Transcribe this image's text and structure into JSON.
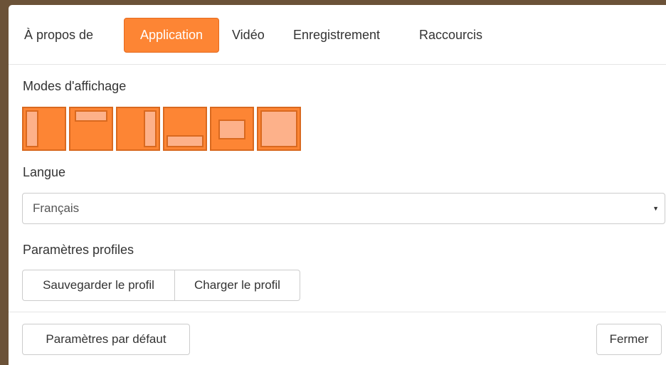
{
  "tabs": [
    {
      "label": "À propos de",
      "active": false
    },
    {
      "label": "Application",
      "active": true
    },
    {
      "label": "Vidéo",
      "active": false
    },
    {
      "label": "Enregistrement",
      "active": false
    },
    {
      "label": "Raccourcis",
      "active": false
    }
  ],
  "display_modes": {
    "label": "Modes d'affichage",
    "modes": [
      {
        "name": "left-panel-icon"
      },
      {
        "name": "top-panel-icon"
      },
      {
        "name": "right-panel-icon"
      },
      {
        "name": "bottom-panel-icon"
      },
      {
        "name": "center-panel-icon"
      },
      {
        "name": "fullscreen-panel-icon"
      }
    ]
  },
  "language": {
    "label": "Langue",
    "selected": "Français"
  },
  "profiles": {
    "label": "Paramètres profiles",
    "save_label": "Sauvegarder le profil",
    "load_label": "Charger le profil"
  },
  "footer": {
    "defaults_label": "Paramètres par défaut",
    "close_label": "Fermer"
  },
  "colors": {
    "accent": "#fd8534",
    "accent_border": "#e5691d",
    "pane_fill": "#fdb18a"
  }
}
